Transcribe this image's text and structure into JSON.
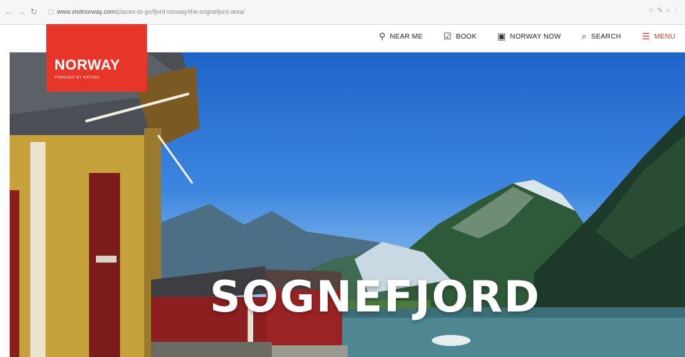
{
  "browser": {
    "url_host": "www.visitnorway.com",
    "url_path": "/places-to-go/fjord-norway/the-sognefjord-area/"
  },
  "site": {
    "logo_main": "NORWAY",
    "logo_sub": "POWERED BY NATURE",
    "brand_color": "#e8352a",
    "nav": [
      {
        "label": "NEAR ME",
        "icon": "map-pin-icon"
      },
      {
        "label": "BOOK",
        "icon": "checkbox-icon"
      },
      {
        "label": "NORWAY NOW",
        "icon": "photo-icon"
      },
      {
        "label": "SEARCH",
        "icon": "search-icon"
      },
      {
        "label": "MENU",
        "icon": "hamburger-icon"
      }
    ]
  },
  "hero": {
    "title": "SOGNEFJORD"
  }
}
